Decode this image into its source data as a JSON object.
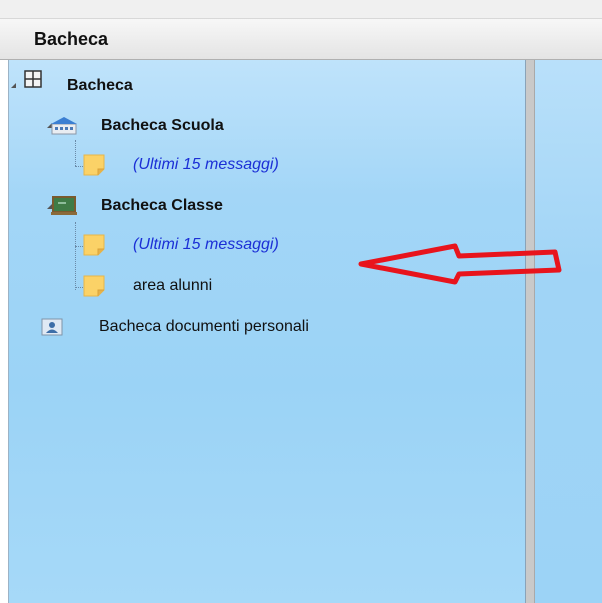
{
  "header": {
    "title": "Bacheca"
  },
  "tree": {
    "root": {
      "label": "Bacheca",
      "icon": "grid-icon"
    },
    "scuola": {
      "label": "Bacheca Scuola",
      "icon": "school-building-icon",
      "children": [
        {
          "label": "(Ultimi 15 messaggi)",
          "icon": "sticky-note-icon"
        }
      ]
    },
    "classe": {
      "label": "Bacheca Classe",
      "icon": "blackboard-icon",
      "children": [
        {
          "label": "(Ultimi 15 messaggi)",
          "icon": "sticky-note-icon"
        },
        {
          "label": "area alunni",
          "icon": "sticky-note-icon"
        }
      ]
    },
    "documenti": {
      "label": "Bacheca documenti personali",
      "icon": "user-card-icon"
    }
  },
  "annotation": {
    "icon": "red-arrow-icon",
    "color": "#e8141c"
  },
  "colors": {
    "link": "#1b2fd6",
    "pane": "#9fd4f6"
  }
}
